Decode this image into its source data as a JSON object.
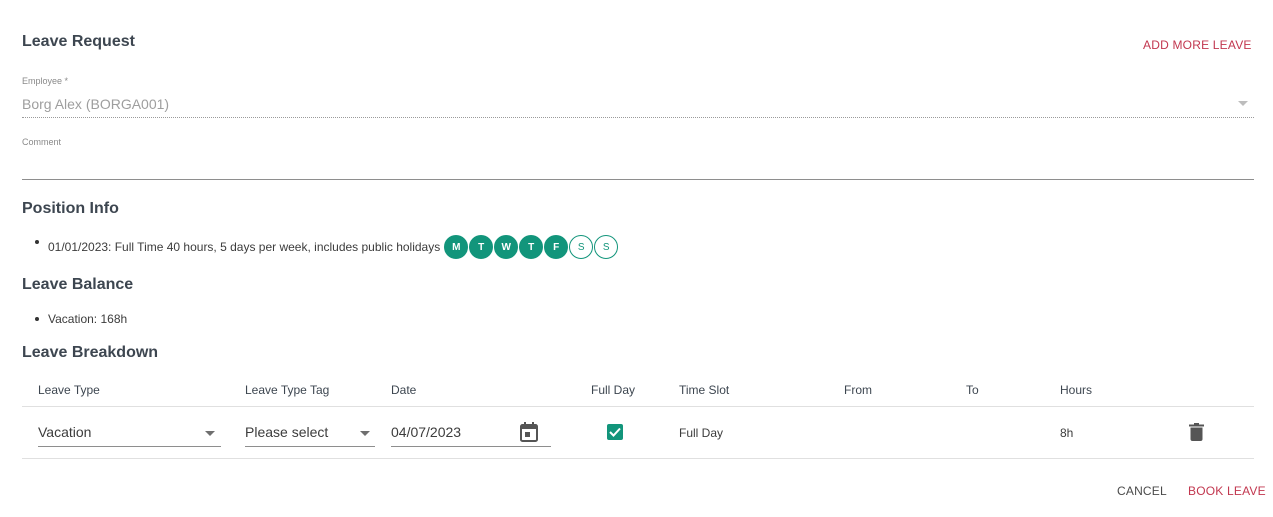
{
  "header": {
    "title": "Leave Request",
    "add_more_label": "ADD MORE LEAVE"
  },
  "employee": {
    "label": "Employee *",
    "value": "Borg Alex (BORGA001)"
  },
  "comment": {
    "label": "Comment",
    "value": ""
  },
  "position_info": {
    "title": "Position Info",
    "items": [
      "01/01/2023: Full Time 40 hours, 5 days per week, includes public holidays"
    ],
    "days": [
      {
        "label": "M",
        "active": true
      },
      {
        "label": "T",
        "active": true
      },
      {
        "label": "W",
        "active": true
      },
      {
        "label": "T",
        "active": true
      },
      {
        "label": "F",
        "active": true
      },
      {
        "label": "S",
        "active": false
      },
      {
        "label": "S",
        "active": false
      }
    ]
  },
  "leave_balance": {
    "title": "Leave Balance",
    "items": [
      "Vacation: 168h"
    ]
  },
  "leave_breakdown": {
    "title": "Leave Breakdown",
    "columns": [
      "Leave Type",
      "Leave Type Tag",
      "Date",
      "Full Day",
      "Time Slot",
      "From",
      "To",
      "Hours"
    ],
    "rows": [
      {
        "leave_type": "Vacation",
        "leave_type_tag": "Please select",
        "date": "04/07/2023",
        "full_day": true,
        "time_slot": "Full Day",
        "from": "",
        "to": "",
        "hours": "8h"
      }
    ]
  },
  "footer": {
    "cancel_label": "CANCEL",
    "book_label": "BOOK LEAVE"
  },
  "colors": {
    "accent": "#c2374f",
    "teal": "#12957b"
  },
  "icons": {
    "calendar": "calendar-icon",
    "delete": "trash-icon",
    "check": "check-icon",
    "dropdown": "chevron-down-icon"
  }
}
